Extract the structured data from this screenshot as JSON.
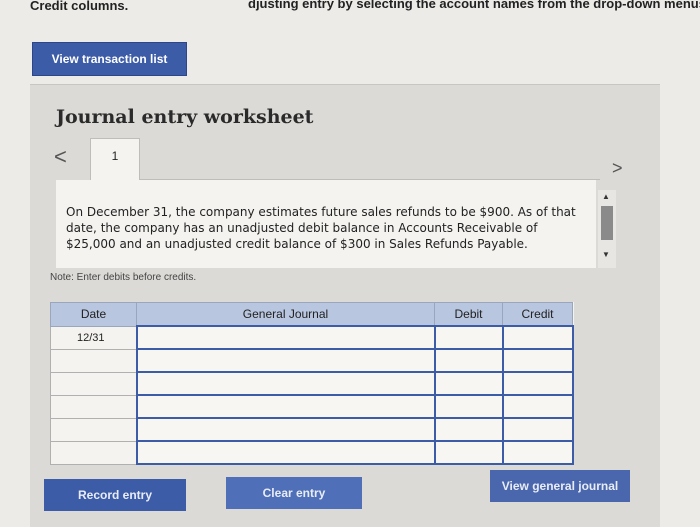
{
  "header": {
    "left_text": "Credit columns.",
    "right_text": "djusting entry by selecting the account names from the drop-down menus and"
  },
  "view_transaction_list_label": "View transaction list",
  "worksheet": {
    "title": "Journal entry worksheet",
    "prev_label": "<",
    "next_label": ">",
    "tab_label": "1",
    "description": "On December 31, the company estimates future sales refunds to be $900. As of that date, the company has an unadjusted debit balance in Accounts Receivable of $25,000 and an unadjusted credit balance of $300 in Sales Refunds Payable.",
    "note": "Note: Enter debits before credits."
  },
  "table": {
    "headers": [
      "Date",
      "General Journal",
      "Debit",
      "Credit"
    ],
    "rows": [
      {
        "date": "12/31"
      },
      {
        "date": ""
      },
      {
        "date": ""
      },
      {
        "date": ""
      },
      {
        "date": ""
      },
      {
        "date": ""
      }
    ]
  },
  "buttons": {
    "record": "Record entry",
    "clear": "Clear entry",
    "view_general_journal": "View general journal"
  },
  "colors": {
    "accent": "#3d5ca8",
    "table_header": "#b8c6df"
  }
}
